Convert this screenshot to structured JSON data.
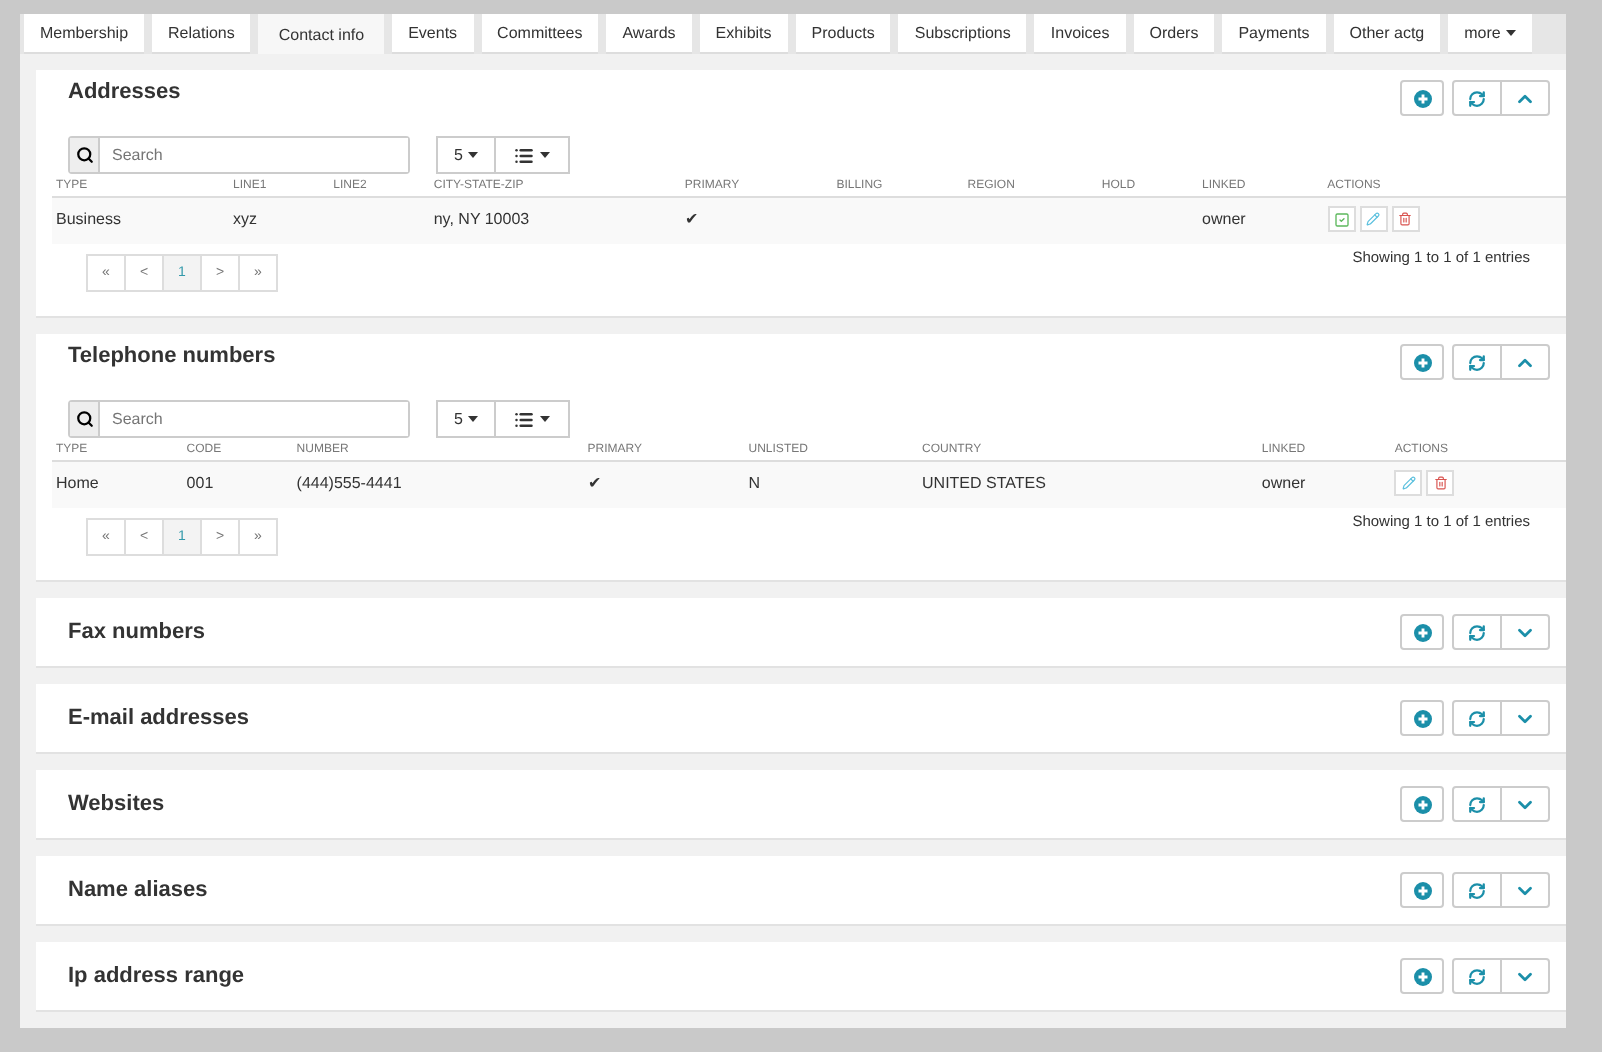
{
  "tabs": [
    {
      "label": "Membership",
      "selected": false
    },
    {
      "label": "Relations",
      "selected": false
    },
    {
      "label": "Contact info",
      "selected": true
    },
    {
      "label": "Events",
      "selected": false
    },
    {
      "label": "Committees",
      "selected": false
    },
    {
      "label": "Awards",
      "selected": false
    },
    {
      "label": "Exhibits",
      "selected": false
    },
    {
      "label": "Products",
      "selected": false
    },
    {
      "label": "Subscriptions",
      "selected": false
    },
    {
      "label": "Invoices",
      "selected": false
    },
    {
      "label": "Orders",
      "selected": false
    },
    {
      "label": "Payments",
      "selected": false
    },
    {
      "label": "Other actg",
      "selected": false
    },
    {
      "label": "more",
      "selected": false,
      "kind": "dropdown"
    }
  ],
  "panels": [
    {
      "title": "Addresses",
      "expanded": true,
      "search": {
        "placeholder": "Search"
      },
      "page_size": "5",
      "columns": [
        "TYPE",
        "LINE1",
        "LINE2",
        "CITY-STATE-ZIP",
        "PRIMARY",
        "BILLING",
        "REGION",
        "HOLD",
        "LINKED",
        "ACTIONS"
      ],
      "rows": [
        {
          "cells": [
            "Business",
            "xyz",
            "",
            "ny, NY 10003",
            "✔",
            "",
            "",
            "",
            "owner"
          ],
          "actions": [
            {
              "kind": "view"
            },
            {
              "kind": "edit"
            },
            {
              "kind": "delete"
            }
          ]
        }
      ],
      "pager": [
        {
          "label": "«",
          "selected": false
        },
        {
          "label": "<",
          "selected": false
        },
        {
          "label": "1",
          "selected": true
        },
        {
          "label": ">",
          "selected": false
        },
        {
          "label": "»",
          "selected": false
        }
      ],
      "info": "Showing 1 to 1 of 1 entries"
    },
    {
      "title": "Telephone numbers",
      "expanded": true,
      "search": {
        "placeholder": "Search"
      },
      "page_size": "5",
      "columns": [
        "TYPE",
        "CODE",
        "NUMBER",
        "PRIMARY",
        "UNLISTED",
        "COUNTRY",
        "LINKED",
        "ACTIONS"
      ],
      "rows": [
        {
          "cells": [
            "Home",
            "001",
            "(444)555-4441",
            "✔",
            "N",
            "UNITED STATES",
            "owner"
          ],
          "actions": [
            {
              "kind": "edit"
            },
            {
              "kind": "delete"
            }
          ]
        }
      ],
      "pager": [
        {
          "label": "«",
          "selected": false
        },
        {
          "label": "<",
          "selected": false
        },
        {
          "label": "1",
          "selected": true
        },
        {
          "label": ">",
          "selected": false
        },
        {
          "label": "»",
          "selected": false
        }
      ],
      "info": "Showing 1 to 1 of 1 entries"
    },
    {
      "title": "Fax numbers",
      "expanded": false
    },
    {
      "title": "E-mail addresses",
      "expanded": false
    },
    {
      "title": "Websites",
      "expanded": false
    },
    {
      "title": "Name aliases",
      "expanded": false
    },
    {
      "title": "Ip address range",
      "expanded": false
    }
  ]
}
